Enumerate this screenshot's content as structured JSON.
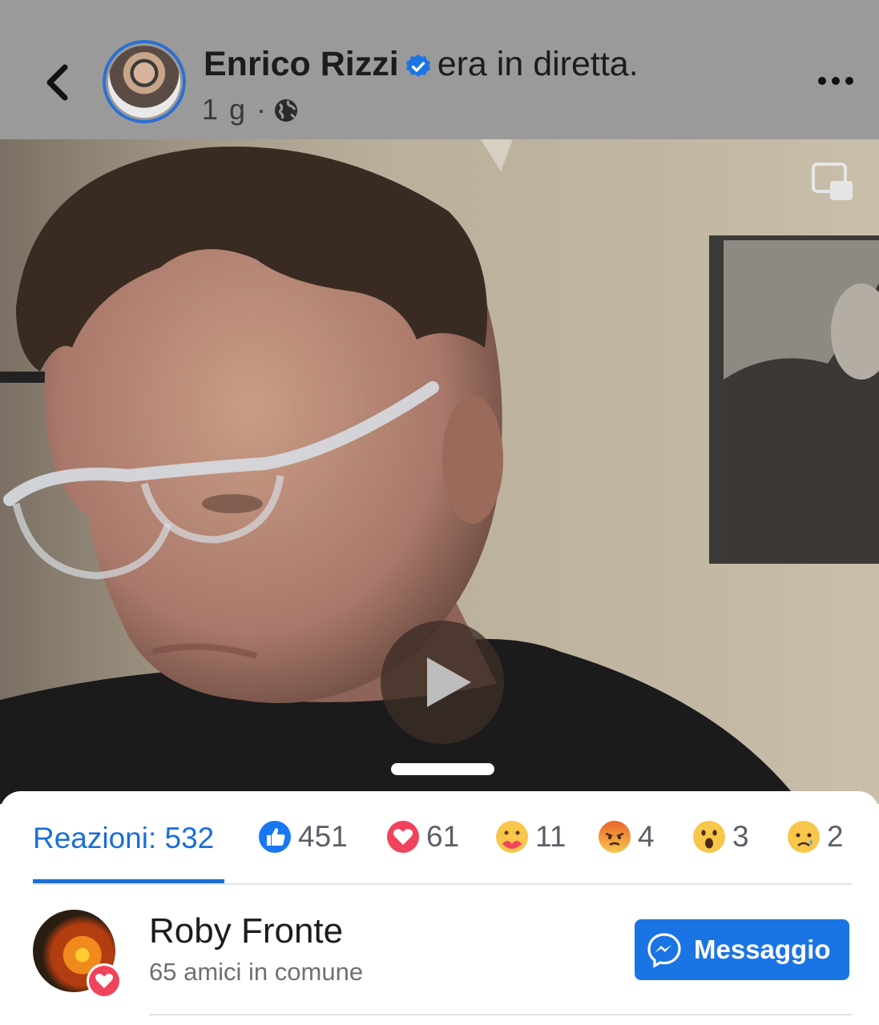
{
  "header": {
    "author_name": "Enrico Rizzi",
    "status_text": "era in diretta.",
    "time_ago": "1 g ·"
  },
  "icons": {
    "back": "chevron-left-icon",
    "verified": "verified-badge-icon",
    "audience": "globe-icon",
    "more": "more-dots-icon",
    "pip": "picture-in-picture-icon",
    "play": "play-icon",
    "messenger": "messenger-icon"
  },
  "reactions": {
    "all_label": "Reazioni: 532",
    "items": [
      {
        "type": "like",
        "count": "451"
      },
      {
        "type": "love",
        "count": "61"
      },
      {
        "type": "care",
        "count": "11"
      },
      {
        "type": "angry",
        "count": "4"
      },
      {
        "type": "wow",
        "count": "3"
      },
      {
        "type": "sad",
        "count": "2"
      }
    ]
  },
  "people": [
    {
      "name": "Roby Fronte",
      "mutual": "65 amici in comune",
      "reaction": "love",
      "button_label": "Messaggio"
    }
  ],
  "colors": {
    "accent": "#1a6ed8",
    "button": "#1b74e4",
    "header_bg": "#9a9a9a",
    "like": "#1877f2",
    "love": "#f0445c",
    "emoji_yellow": "#f7c64a",
    "angry": "#e9662c"
  }
}
